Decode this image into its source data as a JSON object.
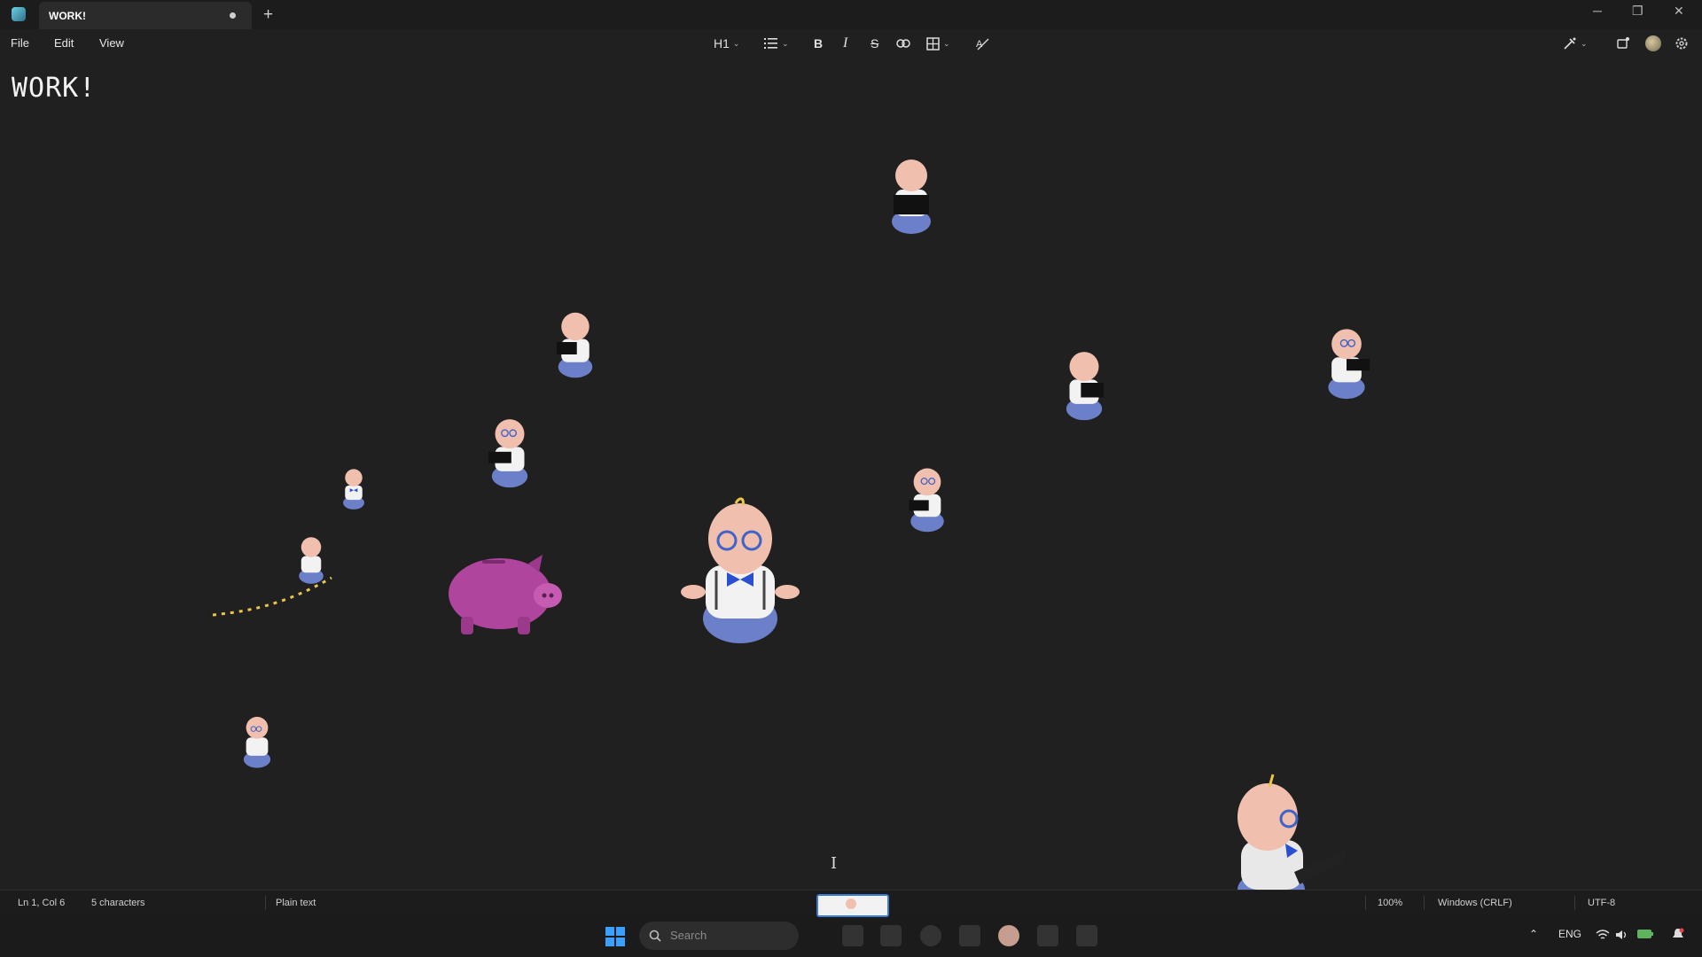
{
  "window": {
    "tab_title": "WORK!",
    "new_tab_glyph": "+",
    "controls": [
      "─",
      "❐",
      "✕"
    ]
  },
  "menu": {
    "file": "File",
    "edit": "Edit",
    "view": "View"
  },
  "toolbar": {
    "heading": "H1",
    "bold": "B",
    "italic": "I",
    "strike": "S",
    "icons": [
      "list-icon",
      "link-icon",
      "table-icon",
      "clear-format-icon",
      "copilot-icon",
      "share-icon",
      "settings-icon"
    ]
  },
  "document": {
    "text": "WORK!"
  },
  "status": {
    "position": "Ln 1, Col 6",
    "characters": "5 characters",
    "format": "Plain text",
    "zoom": "100%",
    "line_ending": "Windows (CRLF)",
    "encoding": "UTF-8"
  },
  "taskbar": {
    "search_placeholder": "Search",
    "language": "ENG"
  },
  "colors": {
    "background": "#202020",
    "pig": "#b0459e",
    "shirt": "#f2f2f2",
    "pants": "#6b80c9",
    "skin": "#f0bfae",
    "accent": "#3a7bd5"
  }
}
